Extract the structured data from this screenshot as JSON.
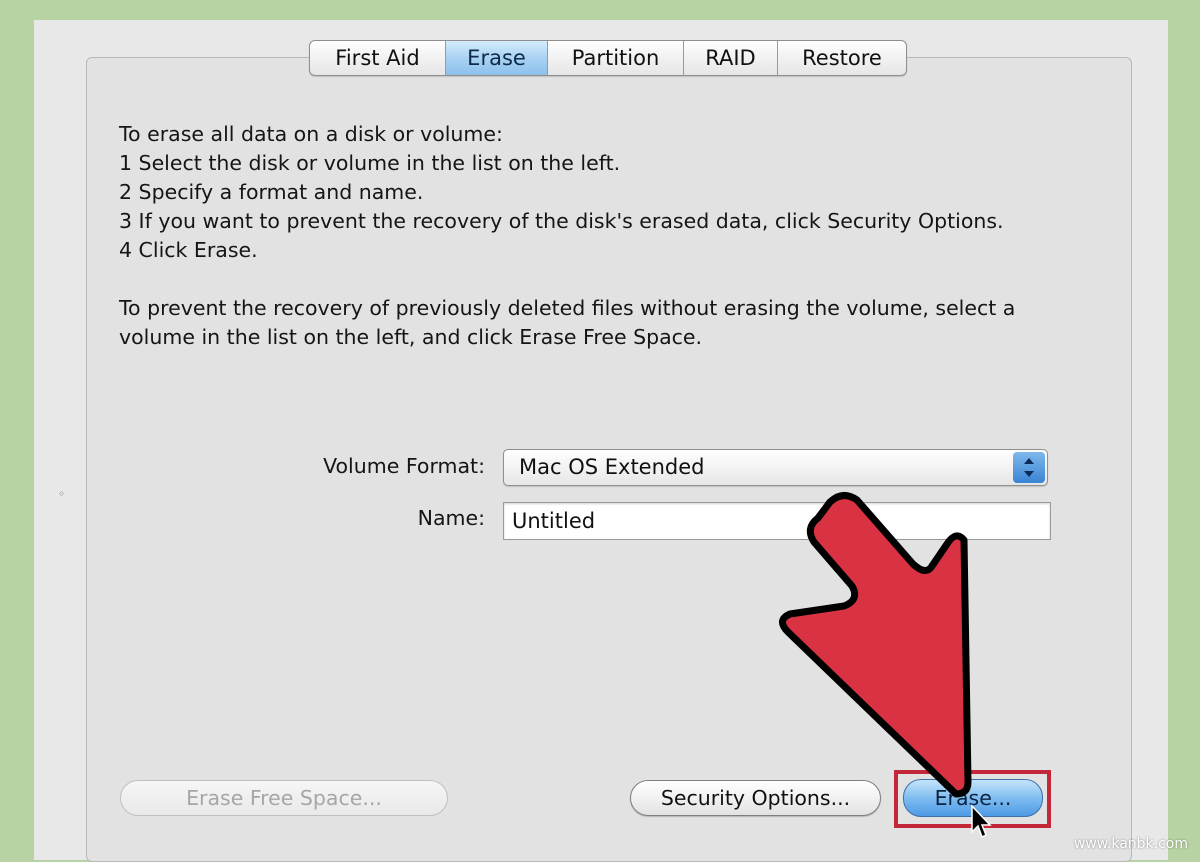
{
  "tabs": [
    {
      "label": "First Aid",
      "active": false
    },
    {
      "label": "Erase",
      "active": true
    },
    {
      "label": "Partition",
      "active": false
    },
    {
      "label": "RAID",
      "active": false
    },
    {
      "label": "Restore",
      "active": false
    }
  ],
  "instructions": {
    "line1": "To erase all data on a disk or volume:",
    "line2": "1  Select the disk or volume in the list on the left.",
    "line3": "2  Specify a format and name.",
    "line4": "3  If you want to prevent the recovery of the disk's erased data, click Security Options.",
    "line5": "4  Click Erase.",
    "paragraph2_line1": "To prevent the recovery of previously deleted files without erasing the volume, select a",
    "paragraph2_line2": "volume in the list on the left, and click Erase Free Space."
  },
  "form": {
    "volume_format_label": "Volume Format:",
    "volume_format_value": "Mac OS Extended",
    "name_label": "Name:",
    "name_value": "Untitled"
  },
  "buttons": {
    "erase_free_space": "Erase Free Space...",
    "security_options": "Security Options...",
    "erase": "Erase..."
  },
  "colors": {
    "annotation_arrow": "#d93343",
    "selected_tab": "#a9d2f3",
    "background": "#b7d3a3"
  },
  "icons": [
    "stepper-icon",
    "annotation-arrow-icon",
    "mouse-cursor-icon"
  ],
  "watermark": "www.kanbk.com"
}
